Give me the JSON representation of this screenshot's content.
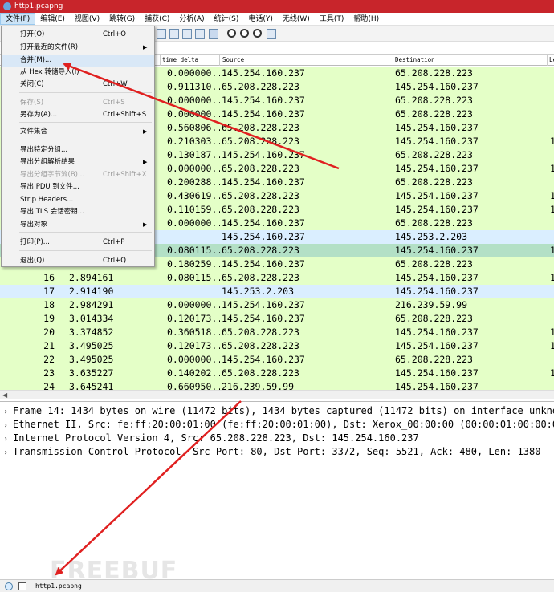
{
  "window": {
    "title": "http1.pcapng"
  },
  "menubar": [
    "文件(F)",
    "编辑(E)",
    "视图(V)",
    "跳转(G)",
    "捕获(C)",
    "分析(A)",
    "统计(S)",
    "电话(Y)",
    "无线(W)",
    "工具(T)",
    "帮助(H)"
  ],
  "file_menu": {
    "items": [
      {
        "label": "打开(O)",
        "shortcut": "Ctrl+O"
      },
      {
        "label": "打开最近的文件(R)",
        "shortcut": ""
      },
      {
        "label": "合并(M)...",
        "shortcut": ""
      },
      {
        "label": "从 Hex 转储导入(I)",
        "shortcut": ""
      },
      {
        "label": "关闭(C)",
        "shortcut": "Ctrl+W"
      },
      {
        "label": "保存(S)",
        "shortcut": "Ctrl+S"
      },
      {
        "label": "另存为(A)...",
        "shortcut": "Ctrl+Shift+S"
      },
      {
        "label": "文件集合",
        "shortcut": ""
      },
      {
        "label": "导出特定分组...",
        "shortcut": ""
      },
      {
        "label": "导出分组解析结果",
        "shortcut": ""
      },
      {
        "label": "导出分组字节流(B)...",
        "shortcut": "Ctrl+Shift+X"
      },
      {
        "label": "导出 PDU 到文件...",
        "shortcut": ""
      },
      {
        "label": "Strip Headers...",
        "shortcut": ""
      },
      {
        "label": "导出 TLS 会话密钥...",
        "shortcut": ""
      },
      {
        "label": "导出对象",
        "shortcut": ""
      },
      {
        "label": "打印(P)...",
        "shortcut": "Ctrl+P"
      },
      {
        "label": "退出(Q)",
        "shortcut": "Ctrl+Q"
      }
    ]
  },
  "packet_list": {
    "columns": [
      "time_delta",
      "Source",
      "Destination",
      "Le"
    ],
    "rows": [
      {
        "no": "",
        "time": "",
        "delta": "0.000000...",
        "src": "145.254.160.237",
        "dst": "65.208.228.223",
        "len": "",
        "color": "#e4ffc7"
      },
      {
        "no": "",
        "time": "",
        "delta": "0.911310...",
        "src": "65.208.228.223",
        "dst": "145.254.160.237",
        "len": "",
        "color": "#e4ffc7"
      },
      {
        "no": "",
        "time": "",
        "delta": "0.000000...",
        "src": "145.254.160.237",
        "dst": "65.208.228.223",
        "len": "",
        "color": "#e4ffc7"
      },
      {
        "no": "",
        "time": "",
        "delta": "0.000000...",
        "src": "145.254.160.237",
        "dst": "65.208.228.223",
        "len": "",
        "color": "#e4ffc7"
      },
      {
        "no": "",
        "time": "",
        "delta": "0.560806...",
        "src": "65.208.228.223",
        "dst": "145.254.160.237",
        "len": "",
        "color": "#e4ffc7"
      },
      {
        "no": "",
        "time": "",
        "delta": "0.210303...",
        "src": "65.208.228.223",
        "dst": "145.254.160.237",
        "len": "1",
        "color": "#e4ffc7"
      },
      {
        "no": "",
        "time": "",
        "delta": "0.130187...",
        "src": "145.254.160.237",
        "dst": "65.208.228.223",
        "len": "",
        "color": "#e4ffc7"
      },
      {
        "no": "",
        "time": "",
        "delta": "0.000000...",
        "src": "65.208.228.223",
        "dst": "145.254.160.237",
        "len": "1",
        "color": "#e4ffc7"
      },
      {
        "no": "",
        "time": "",
        "delta": "0.200288...",
        "src": "145.254.160.237",
        "dst": "65.208.228.223",
        "len": "",
        "color": "#e4ffc7"
      },
      {
        "no": "",
        "time": "",
        "delta": "0.430619...",
        "src": "65.208.228.223",
        "dst": "145.254.160.237",
        "len": "1",
        "color": "#e4ffc7"
      },
      {
        "no": "",
        "time": "",
        "delta": "0.110159...",
        "src": "65.208.228.223",
        "dst": "145.254.160.237",
        "len": "1",
        "color": "#e4ffc7"
      },
      {
        "no": "",
        "time": "",
        "delta": "0.000000...",
        "src": "145.254.160.237",
        "dst": "65.208.228.223",
        "len": "",
        "color": "#e4ffc7"
      },
      {
        "no": "",
        "time": "",
        "delta": "",
        "src": "145.254.160.237",
        "dst": "145.253.2.203",
        "len": "",
        "color": "#daeeff"
      },
      {
        "no": "",
        "time": "",
        "delta": "0.080115...",
        "src": "65.208.228.223",
        "dst": "145.254.160.237",
        "len": "1",
        "color": "#b3e0c6"
      },
      {
        "no": "",
        "time": "",
        "delta": "0.180259...",
        "src": "145.254.160.237",
        "dst": "65.208.228.223",
        "len": "",
        "color": "#e4ffc7"
      },
      {
        "no": "16",
        "time": "2.894161",
        "delta": "0.080115...",
        "src": "65.208.228.223",
        "dst": "145.254.160.237",
        "len": "1",
        "color": "#e4ffc7"
      },
      {
        "no": "17",
        "time": "2.914190",
        "delta": "",
        "src": "145.253.2.203",
        "dst": "145.254.160.237",
        "len": "",
        "color": "#daeeff"
      },
      {
        "no": "18",
        "time": "2.984291",
        "delta": "0.000000...",
        "src": "145.254.160.237",
        "dst": "216.239.59.99",
        "len": "",
        "color": "#e4ffc7"
      },
      {
        "no": "19",
        "time": "3.014334",
        "delta": "0.120173...",
        "src": "145.254.160.237",
        "dst": "65.208.228.223",
        "len": "",
        "color": "#e4ffc7"
      },
      {
        "no": "20",
        "time": "3.374852",
        "delta": "0.360518...",
        "src": "65.208.228.223",
        "dst": "145.254.160.237",
        "len": "1",
        "color": "#e4ffc7"
      },
      {
        "no": "21",
        "time": "3.495025",
        "delta": "0.120173...",
        "src": "65.208.228.223",
        "dst": "145.254.160.237",
        "len": "1",
        "color": "#e4ffc7"
      },
      {
        "no": "22",
        "time": "3.495025",
        "delta": "0.000000...",
        "src": "145.254.160.237",
        "dst": "65.208.228.223",
        "len": "",
        "color": "#e4ffc7"
      },
      {
        "no": "23",
        "time": "3.635227",
        "delta": "0.140202...",
        "src": "65.208.228.223",
        "dst": "145.254.160.237",
        "len": "1",
        "color": "#e4ffc7"
      },
      {
        "no": "24",
        "time": "3.645241",
        "delta": "0.660950...",
        "src": "216.239.59.99",
        "dst": "145.254.160.237",
        "len": "",
        "color": "#e4ffc7"
      }
    ]
  },
  "details": [
    "Frame 14: 1434 bytes on wire (11472 bits), 1434 bytes captured (11472 bits) on interface unknown",
    "Ethernet II, Src: fe:ff:20:00:01:00 (fe:ff:20:00:01:00), Dst: Xerox_00:00:00 (00:00:01:00:00:00)",
    "Internet Protocol Version 4, Src: 65.208.228.223, Dst: 145.254.160.237",
    "Transmission Control Protocol, Src Port: 80, Dst Port: 3372, Seq: 5521, Ack: 480, Len: 1380"
  ],
  "statusbar": {
    "file": "http1.pcapng"
  },
  "watermark": "FREEBUF",
  "colors": {
    "title_bar": "#c8252b",
    "arrow": "#e02020",
    "tcp_row": "#e4ffc7",
    "udp_row": "#daeeff",
    "selected_row": "#b3e0c6"
  }
}
